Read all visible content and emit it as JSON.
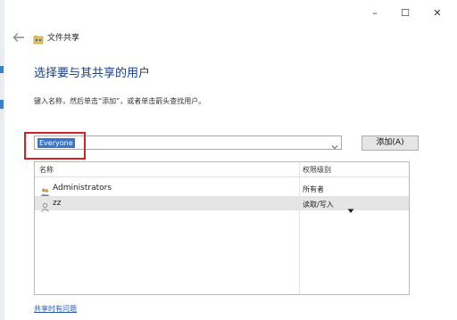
{
  "window": {
    "minimize_glyph": "–",
    "maximize_glyph": "☐",
    "close_glyph": "✕"
  },
  "header": {
    "back_icon": "back-arrow-icon",
    "title": "文件共享"
  },
  "main": {
    "heading": "选择要与其共享的用户",
    "instruction": "键入名称，然后单击“添加”，或者单击箭头查找用户。"
  },
  "picker": {
    "value": "Everyone",
    "add_label": "添加(A)"
  },
  "table": {
    "columns": [
      "名称",
      "权限级别"
    ],
    "rows": [
      {
        "name": "Administrators",
        "permission": "所有者",
        "icon": "group-icon",
        "selected": false
      },
      {
        "name": "zz",
        "permission": "读取/写入",
        "icon": "user-icon",
        "selected": true,
        "has_dropdown": true
      }
    ]
  },
  "footer": {
    "help_link": "共享时有问题"
  },
  "colors": {
    "heading": "#1a3e8c",
    "selection": "#3b73c9",
    "highlight": "#d0242a",
    "link": "#2a5db0"
  }
}
